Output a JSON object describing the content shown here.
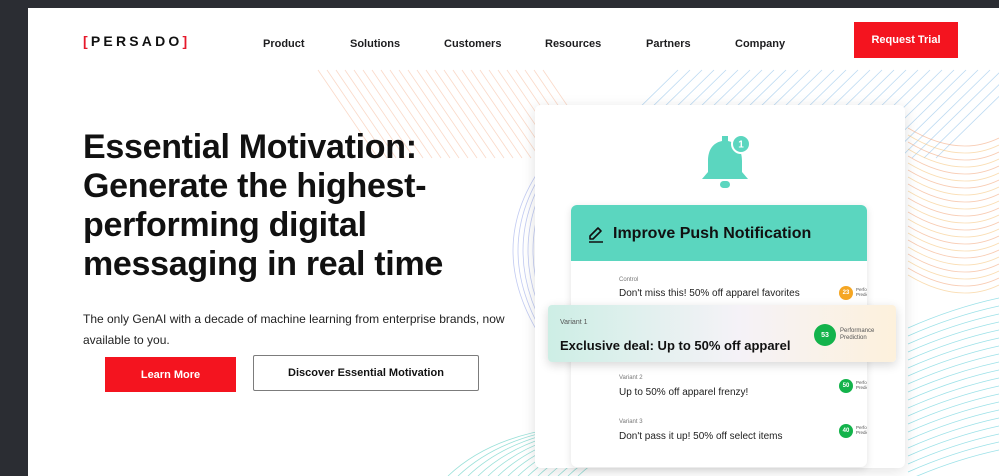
{
  "brand": {
    "logo_left": "[",
    "logo_text": "PERSADO",
    "logo_right": "]",
    "accent": "#f4141f",
    "teal": "#5bd6bf"
  },
  "nav": {
    "items": [
      "Product",
      "Solutions",
      "Customers",
      "Resources",
      "Partners",
      "Company"
    ],
    "cta": "Request Trial"
  },
  "hero": {
    "title": "Essential Motivation: Generate the highest-performing digital messaging in real time",
    "subtitle": "The only GenAI with a decade of machine learning from enterprise brands, now available to you.",
    "primary_button": "Learn More",
    "secondary_button": "Discover Essential Motivation"
  },
  "card": {
    "badge_count": "1",
    "title": "Improve Push Notification",
    "perf_label": "Performance Prediction",
    "control": {
      "label": "Control",
      "text": "Don't miss this! 50% off apparel favorites",
      "score": "23"
    },
    "variant1": {
      "label": "Variant 1",
      "text": "Exclusive deal: Up to 50% off apparel",
      "score": "53"
    },
    "variant2": {
      "label": "Variant 2",
      "text": "Up to 50% off apparel frenzy!",
      "score": "50"
    },
    "variant3": {
      "label": "Variant 3",
      "text": "Don't pass it up! 50% off select items",
      "score": "40"
    }
  },
  "colors": {
    "score_low": "#f5a623",
    "score_good": "#13b34b",
    "bell": "#5bd6bf"
  }
}
